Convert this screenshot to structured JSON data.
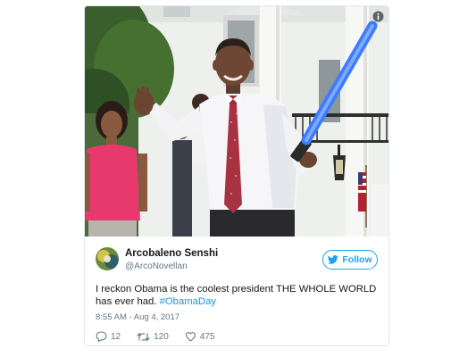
{
  "tweet": {
    "display_name": "Arcobaleno Senshi",
    "handle": "@ArcoNovellan",
    "follow_label": "Follow",
    "text_main": "I reckon Obama is the coolest president THE WHOLE WORLD has ever had. ",
    "hashtag": "#ObamaDay",
    "timestamp": "8:55 AM - Aug 4, 2017",
    "replies": "12",
    "retweets": "120",
    "likes": "475"
  },
  "icons": {
    "info": "info-icon",
    "follow": "twitter-bird-icon",
    "reply": "reply-icon",
    "retweet": "retweet-icon",
    "like": "heart-icon"
  },
  "colors": {
    "accent": "#1da1f2",
    "hashtag": "#1b95e0",
    "muted": "#657786",
    "lightsaber": "#3b7bff"
  }
}
